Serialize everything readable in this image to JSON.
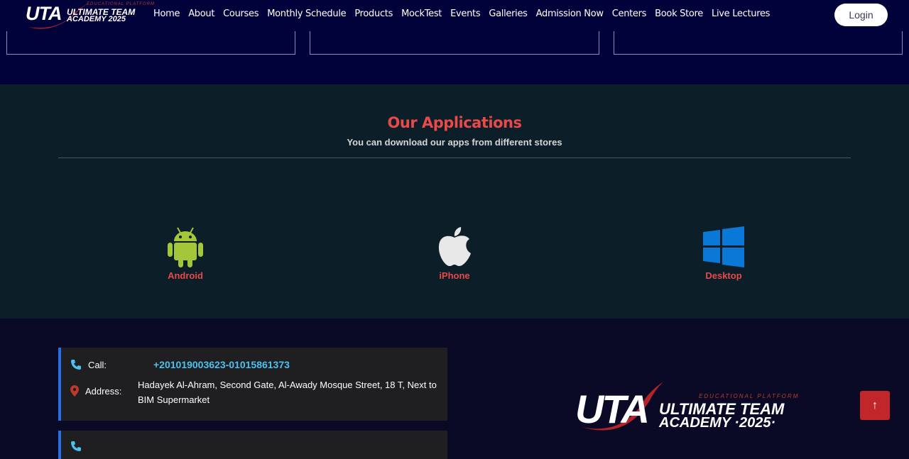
{
  "header": {
    "logo": {
      "mark": "UTA",
      "tagline": "EDUCATIONAL PLATFORM",
      "line1": "ULTIMATE TEAM",
      "line2": "ACADEMY 2025"
    },
    "nav": [
      {
        "label": "Home"
      },
      {
        "label": "About"
      },
      {
        "label": "Courses"
      },
      {
        "label": "Monthly Schedule"
      },
      {
        "label": "Products"
      },
      {
        "label": "MockTest"
      },
      {
        "label": "Events"
      },
      {
        "label": "Galleries"
      },
      {
        "label": "Admission Now"
      },
      {
        "label": "Centers"
      },
      {
        "label": "Book Store"
      },
      {
        "label": "Live Lectures"
      }
    ],
    "login_label": "Login"
  },
  "applications": {
    "title": "Our Applications",
    "subtitle": "You can download our apps from different stores",
    "items": [
      {
        "label": "Android",
        "icon": "android-icon",
        "color": "#a4c639"
      },
      {
        "label": "iPhone",
        "icon": "apple-icon",
        "color": "#e8e8e8"
      },
      {
        "label": "Desktop",
        "icon": "windows-icon",
        "color": "#0a78d7"
      }
    ]
  },
  "footer": {
    "call_label": "Call:",
    "phone": "+201019003623-01015861373",
    "address_label": "Address:",
    "address": "Hadayek Al-Ahram, Second Gate, Al-Awady Mosque Street, 18 T, Next to BIM Supermarket",
    "logo": {
      "mark": "UTA",
      "tagline": "EDUCATIONAL PLATFORM",
      "line1": "ULTIMATE TEAM",
      "line2": "ACADEMY ·2025·"
    }
  },
  "colors": {
    "accent": "#e84a4a",
    "link": "#4cc2f0",
    "navy": "#02023a",
    "border_blue": "#2a6ee0"
  }
}
